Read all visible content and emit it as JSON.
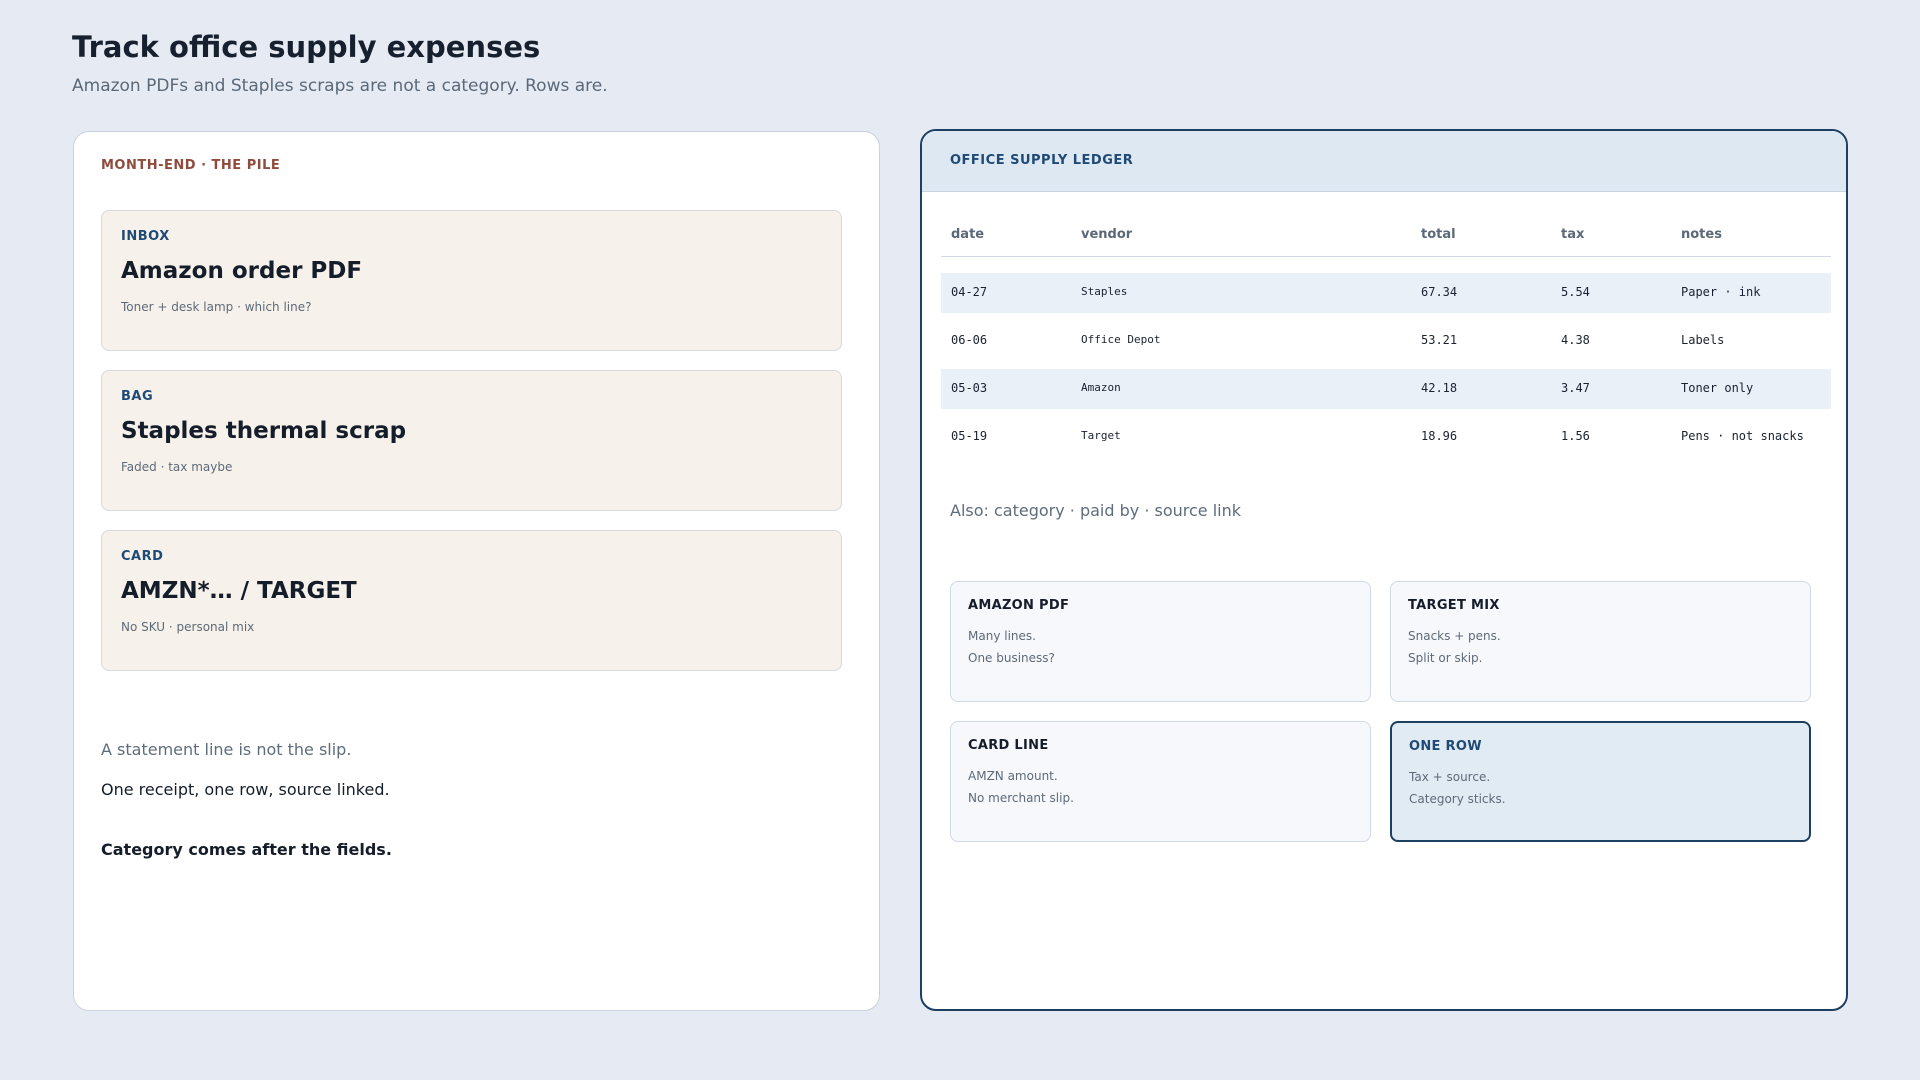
{
  "page": {
    "title": "Track office supply expenses",
    "subtitle": "Amazon PDFs and Staples scraps are not a category. Rows are."
  },
  "pile": {
    "eyebrow": "MONTH-END · THE PILE",
    "cards": [
      {
        "kind": "INBOX",
        "title": "Amazon order PDF",
        "note": "Toner + desk lamp · which line?"
      },
      {
        "kind": "BAG",
        "title": "Staples thermal scrap",
        "note": "Faded · tax maybe"
      },
      {
        "kind": "CARD",
        "title": "AMZN*… / TARGET",
        "note": "No SKU · personal mix"
      }
    ],
    "line1": "A statement line is not the slip.",
    "line2": "One receipt, one row, source linked.",
    "line3": "Category comes after the fields."
  },
  "ledger": {
    "title": "OFFICE SUPPLY LEDGER",
    "columns": [
      "date",
      "vendor",
      "total",
      "tax",
      "notes"
    ],
    "rows": [
      {
        "date": "04-27",
        "vendor": "Staples",
        "total": "67.34",
        "tax": "5.54",
        "notes": "Paper · ink"
      },
      {
        "date": "06-06",
        "vendor": "Office Depot",
        "total": "53.21",
        "tax": "4.38",
        "notes": "Labels"
      },
      {
        "date": "05-03",
        "vendor": "Amazon",
        "total": "42.18",
        "tax": "3.47",
        "notes": "Toner only"
      },
      {
        "date": "05-19",
        "vendor": "Target",
        "total": "18.96",
        "tax": "1.56",
        "notes": "Pens · not snacks"
      }
    ],
    "also": "Also: category · paid by · source link",
    "options": [
      {
        "title": "AMAZON PDF",
        "line1": "Many lines.",
        "line2": "One business?"
      },
      {
        "title": "TARGET MIX",
        "line1": "Snacks + pens.",
        "line2": "Split or skip."
      },
      {
        "title": "CARD LINE",
        "line1": "AMZN amount.",
        "line2": "No merchant slip."
      },
      {
        "title": "ONE ROW",
        "line1": "Tax + source.",
        "line2": "Category sticks."
      }
    ],
    "selected_option": "ONE ROW"
  },
  "colors": {
    "background": "#e6ebf3",
    "accent": "#1d3f62",
    "eyebrow_red": "#8f4b3e",
    "slip_card": "#f6f2eb",
    "row_shade": "#eaf0f8"
  }
}
